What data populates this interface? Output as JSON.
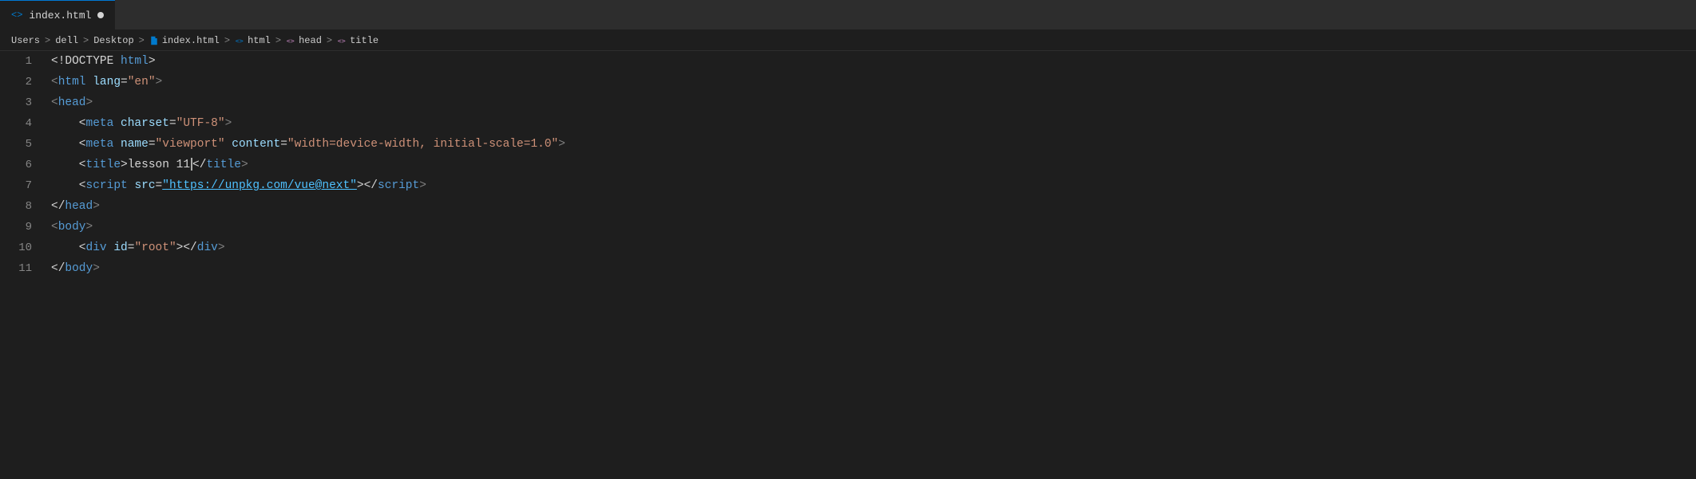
{
  "tab": {
    "filename": "index.html",
    "icon": "<>",
    "modified": true
  },
  "breadcrumb": {
    "items": [
      {
        "label": "Users",
        "type": "text"
      },
      {
        "label": ">",
        "type": "separator"
      },
      {
        "label": "dell",
        "type": "text"
      },
      {
        "label": ">",
        "type": "separator"
      },
      {
        "label": "Desktop",
        "type": "text"
      },
      {
        "label": ">",
        "type": "separator"
      },
      {
        "label": "index.html",
        "type": "code",
        "iconType": "file"
      },
      {
        "label": ">",
        "type": "separator"
      },
      {
        "label": "html",
        "type": "code",
        "iconType": "tag"
      },
      {
        "label": ">",
        "type": "separator"
      },
      {
        "label": "head",
        "type": "code",
        "iconType": "tag"
      },
      {
        "label": ">",
        "type": "separator"
      },
      {
        "label": "title",
        "type": "code",
        "iconType": "tag"
      }
    ]
  },
  "lines": [
    {
      "number": "1",
      "tokens": [
        {
          "text": "<!DOCTYPE ",
          "class": "doctype-text"
        },
        {
          "text": "html",
          "class": "doctype-keyword"
        },
        {
          "text": ">",
          "class": "doctype-text"
        }
      ]
    },
    {
      "number": "2",
      "tokens": [
        {
          "text": "<",
          "class": "bracket"
        },
        {
          "text": "html",
          "class": "tag"
        },
        {
          "text": " ",
          "class": "plain"
        },
        {
          "text": "lang",
          "class": "attr"
        },
        {
          "text": "=",
          "class": "plain"
        },
        {
          "text": "\"en\"",
          "class": "string"
        },
        {
          "text": ">",
          "class": "bracket"
        }
      ]
    },
    {
      "number": "3",
      "tokens": [
        {
          "text": "<",
          "class": "bracket"
        },
        {
          "text": "head",
          "class": "tag"
        },
        {
          "text": ">",
          "class": "bracket"
        }
      ]
    },
    {
      "number": "4",
      "tokens": [
        {
          "text": "    <",
          "class": "plain"
        },
        {
          "text": "meta",
          "class": "tag"
        },
        {
          "text": " ",
          "class": "plain"
        },
        {
          "text": "charset",
          "class": "attr"
        },
        {
          "text": "=",
          "class": "plain"
        },
        {
          "text": "\"UTF-8\"",
          "class": "string"
        },
        {
          "text": ">",
          "class": "bracket"
        }
      ]
    },
    {
      "number": "5",
      "tokens": [
        {
          "text": "    <",
          "class": "plain"
        },
        {
          "text": "meta",
          "class": "tag"
        },
        {
          "text": " ",
          "class": "plain"
        },
        {
          "text": "name",
          "class": "attr"
        },
        {
          "text": "=",
          "class": "plain"
        },
        {
          "text": "\"viewport\"",
          "class": "string"
        },
        {
          "text": " ",
          "class": "plain"
        },
        {
          "text": "content",
          "class": "attr"
        },
        {
          "text": "=",
          "class": "plain"
        },
        {
          "text": "\"width=device-width, initial-scale=1.0\"",
          "class": "string"
        },
        {
          "text": ">",
          "class": "bracket"
        }
      ]
    },
    {
      "number": "6",
      "tokens": [
        {
          "text": "    <",
          "class": "plain"
        },
        {
          "text": "title",
          "class": "tag"
        },
        {
          "text": ">lesson 11",
          "class": "plain"
        },
        {
          "text": "cursor",
          "class": "cursor"
        },
        {
          "text": "</",
          "class": "plain"
        },
        {
          "text": "title",
          "class": "tag"
        },
        {
          "text": ">",
          "class": "bracket"
        }
      ]
    },
    {
      "number": "7",
      "tokens": [
        {
          "text": "    <",
          "class": "plain"
        },
        {
          "text": "script",
          "class": "tag"
        },
        {
          "text": " ",
          "class": "plain"
        },
        {
          "text": "src",
          "class": "attr"
        },
        {
          "text": "=",
          "class": "plain"
        },
        {
          "text": "\"https://unpkg.com/vue@next\"",
          "class": "url"
        },
        {
          "text": "></",
          "class": "plain"
        },
        {
          "text": "script",
          "class": "tag"
        },
        {
          "text": ">",
          "class": "bracket"
        }
      ]
    },
    {
      "number": "8",
      "tokens": [
        {
          "text": "</",
          "class": "plain"
        },
        {
          "text": "head",
          "class": "tag"
        },
        {
          "text": ">",
          "class": "bracket"
        }
      ]
    },
    {
      "number": "9",
      "tokens": [
        {
          "text": "<",
          "class": "bracket"
        },
        {
          "text": "body",
          "class": "tag"
        },
        {
          "text": ">",
          "class": "bracket"
        }
      ]
    },
    {
      "number": "10",
      "tokens": [
        {
          "text": "    <",
          "class": "plain"
        },
        {
          "text": "div",
          "class": "tag"
        },
        {
          "text": " ",
          "class": "plain"
        },
        {
          "text": "id",
          "class": "attr"
        },
        {
          "text": "=",
          "class": "plain"
        },
        {
          "text": "\"root\"",
          "class": "string"
        },
        {
          "text": "></",
          "class": "plain"
        },
        {
          "text": "div",
          "class": "tag"
        },
        {
          "text": ">",
          "class": "bracket"
        }
      ]
    },
    {
      "number": "11",
      "tokens": [
        {
          "text": "</",
          "class": "plain"
        },
        {
          "text": "body",
          "class": "tag"
        },
        {
          "text": ">",
          "class": "bracket"
        }
      ]
    }
  ]
}
